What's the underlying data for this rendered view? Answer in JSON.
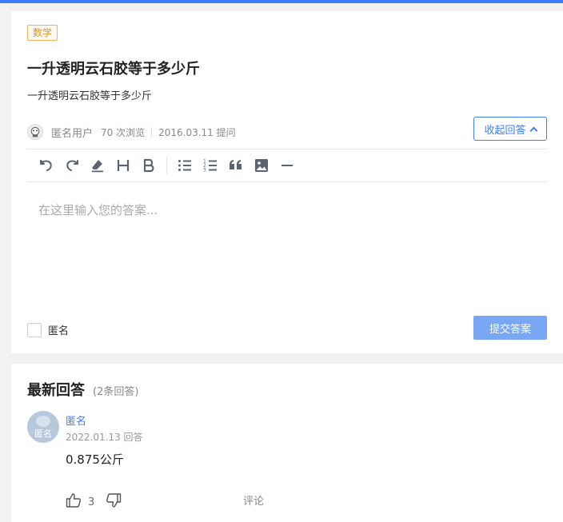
{
  "question": {
    "tag": "数学",
    "title": "一升透明云石胶等于多少斤",
    "description": "一升透明云石胶等于多少斤",
    "author": "匿名用户",
    "views": "70 次浏览",
    "date": "2016.03.11 提问",
    "collapse_label": "收起回答"
  },
  "toolbar": {
    "icons": [
      "undo-icon",
      "redo-icon",
      "eraser-icon",
      "heading-icon",
      "bold-icon",
      "bullet-list-icon",
      "numbered-list-icon",
      "quote-icon",
      "image-icon",
      "horizontal-rule-icon"
    ]
  },
  "editor": {
    "placeholder": "在这里输入您的答案...",
    "anonymous_label": "匿名",
    "submit_label": "提交答案"
  },
  "answers": {
    "title": "最新回答",
    "count": "(2条回答)",
    "items": [
      {
        "avatar_text": "匿名",
        "name": "匿名",
        "date": "2022.01.13 回答",
        "content": "0.875公斤",
        "likes": "3",
        "comment_label": "评论"
      }
    ]
  },
  "colors": {
    "accent": "#3d7eff",
    "tag": "#e6941f",
    "submit_bg": "#7aa7f4",
    "page_bg": "#f2f2f2"
  }
}
